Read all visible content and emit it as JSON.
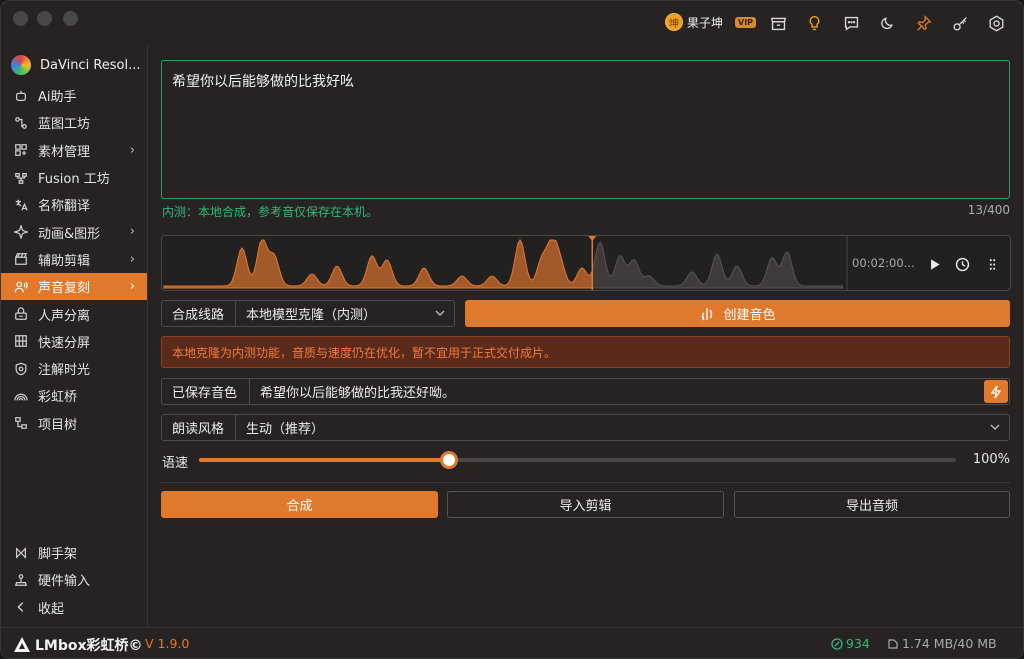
{
  "user": {
    "name": "果子坤",
    "badge": "VIP",
    "avatar_glyph": "坤"
  },
  "app": {
    "name": "DaVinci Resol..."
  },
  "sidebar": {
    "items": [
      {
        "label": "Ai助手",
        "icon": "robot-icon",
        "has_submenu": false
      },
      {
        "label": "蓝图工坊",
        "icon": "blueprint-icon",
        "has_submenu": false
      },
      {
        "label": "素材管理",
        "icon": "assets-icon",
        "has_submenu": true
      },
      {
        "label": "Fusion 工坊",
        "icon": "fusion-icon",
        "has_submenu": false
      },
      {
        "label": "名称翻译",
        "icon": "translate-icon",
        "has_submenu": false
      },
      {
        "label": "动画&图形",
        "icon": "sparkle-icon",
        "has_submenu": true
      },
      {
        "label": "辅助剪辑",
        "icon": "clapper-icon",
        "has_submenu": true
      },
      {
        "label": "声音复刻",
        "icon": "voice-icon",
        "has_submenu": true,
        "active": true
      },
      {
        "label": "人声分离",
        "icon": "separate-icon",
        "has_submenu": false
      },
      {
        "label": "快速分屏",
        "icon": "grid-icon",
        "has_submenu": false
      },
      {
        "label": "注解时光",
        "icon": "shield-icon",
        "has_submenu": false
      },
      {
        "label": "彩虹桥",
        "icon": "rainbow-icon",
        "has_submenu": false
      },
      {
        "label": "项目树",
        "icon": "tree-icon",
        "has_submenu": false
      }
    ],
    "bottom": [
      {
        "label": "脚手架",
        "icon": "scaffold-icon"
      },
      {
        "label": "硬件输入",
        "icon": "joystick-icon"
      },
      {
        "label": "收起",
        "icon": "chevron-left-icon"
      }
    ]
  },
  "editor": {
    "text": "希望你以后能够做的比我好吆",
    "hint": "内测：本地合成，参考音仅保存在本机。",
    "counter": "13/400"
  },
  "waveform": {
    "time": "00:02:00...",
    "playhead": 0.63
  },
  "synthesis": {
    "route_label": "合成线路",
    "route_value": "本地模型克隆（内测）",
    "create_voice_label": "创建音色"
  },
  "warning": "本地克隆为内测功能，音质与速度仍在优化，暂不宜用于正式交付成片。",
  "saved_voice": {
    "label": "已保存音色",
    "value": "希望你以后能够做的比我还好呦。"
  },
  "reading_style": {
    "label": "朗读风格",
    "value": "生动（推荐）"
  },
  "speed": {
    "label": "语速",
    "value_text": "100%",
    "fraction": 0.33
  },
  "actions": {
    "synthesize": "合成",
    "import": "导入剪辑",
    "export": "导出音频"
  },
  "status": {
    "brand": "LMbox彩虹桥©",
    "version": "V 1.9.0",
    "credits": "934",
    "storage": "1.74 MB/40 MB"
  },
  "colors": {
    "accent": "#e0792c",
    "success": "#2fb878",
    "warning_bg": "#5a2a1a"
  }
}
